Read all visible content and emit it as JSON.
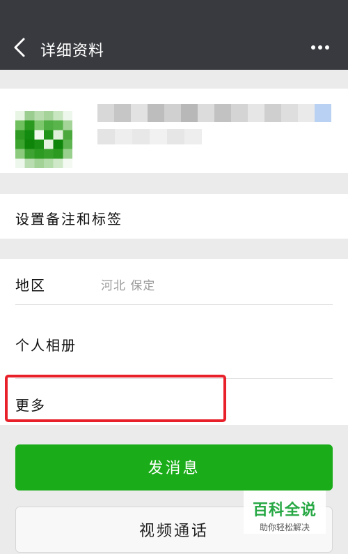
{
  "header": {
    "title": "详细资料",
    "back_icon": "chevron-left-icon",
    "more_icon": "more-dots-icon"
  },
  "profile": {
    "avatar_icon": "avatar"
  },
  "remark": {
    "label": "设置备注和标签"
  },
  "info": {
    "region_label": "地区",
    "region_value": "河北  保定",
    "album_label": "个人相册",
    "more_label": "更多"
  },
  "actions": {
    "send_message": "发消息",
    "video_call": "视频通话"
  },
  "watermark": {
    "main": "百科全说",
    "sub": "助你轻松解决"
  },
  "colors": {
    "header_bg": "#393a3f",
    "primary": "#1aad19",
    "highlight": "#e8202a",
    "watermark": "#27a844"
  }
}
